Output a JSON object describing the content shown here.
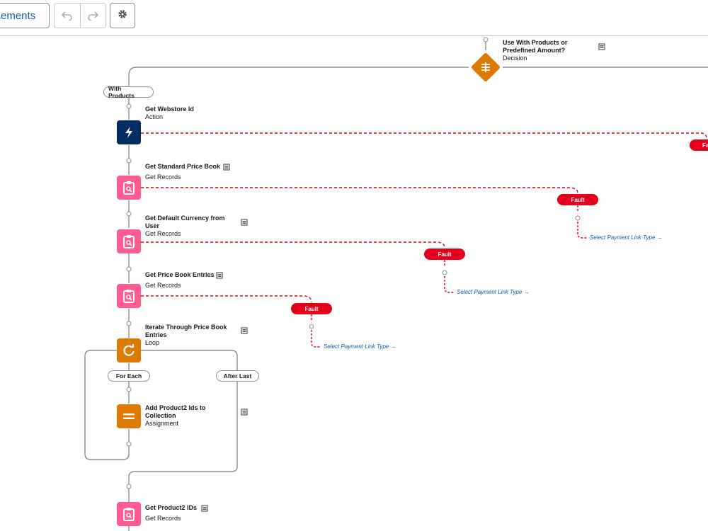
{
  "toolbar": {
    "elements_label": "ements",
    "undo_icon": "undo-icon",
    "redo_icon": "redo-icon",
    "settings_icon": "gear-icon"
  },
  "decision": {
    "title": "Use With Products or Predefined Amount?",
    "title_line1": "Use With Products or",
    "title_line2": "Predefined Amount?",
    "type": "Decision"
  },
  "branches": {
    "with_products": "With Products"
  },
  "nodes": [
    {
      "title": "Get Webstore Id",
      "type": "Action"
    },
    {
      "title": "Get Standard Price Book",
      "type": "Get Records"
    },
    {
      "title_line1": "Get Default Currency from",
      "title_line2": "User",
      "type": "Get Records"
    },
    {
      "title": "Get Price Book Entries",
      "type": "Get Records"
    },
    {
      "title_line1": "Iterate Through Price Book",
      "title_line2": "Entries",
      "type": "Loop"
    },
    {
      "title_line1": "Add Product2 Ids to",
      "title_line2": "Collection",
      "type": "Assignment"
    },
    {
      "title": "Get Product2 IDs",
      "type": "Get Records"
    }
  ],
  "loop": {
    "for_each": "For Each",
    "after_last": "After Last"
  },
  "faults": {
    "label": "Fault",
    "partial_label": "Fa",
    "goto": "Select Payment Link Type →"
  },
  "colors": {
    "action": "#032d60",
    "record": "#ff5d8f",
    "logic": "#dd7a01",
    "fault": "#e3001b",
    "link": "#0b5cab"
  }
}
